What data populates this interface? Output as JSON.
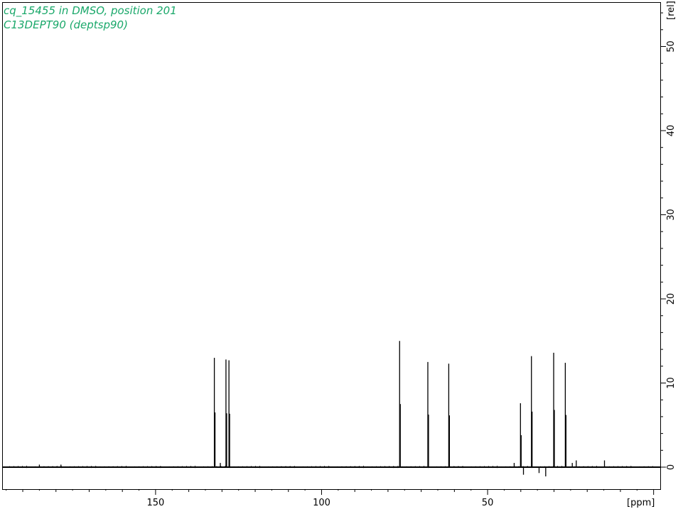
{
  "header": {
    "line1": "cq_15455 in DMSO, position 201",
    "line2": "C13DEPT90 (deptsp90)",
    "color": "#1aa86a"
  },
  "chart_data": {
    "type": "line",
    "xlabel": "[ppm]",
    "ylabel": "[rel]",
    "xlim": [
      196,
      -2
    ],
    "ylim": [
      -2.5,
      55
    ],
    "x_ticks": [
      150,
      100,
      50
    ],
    "x_tick_labels": [
      "150",
      "100",
      "50"
    ],
    "y_ticks": [
      0,
      10,
      20,
      30,
      40,
      50
    ],
    "y_tick_labels": [
      "0",
      "10",
      "20",
      "30",
      "40",
      "50"
    ],
    "baseline": 0,
    "peaks": [
      {
        "ppm": 132.3,
        "height": 13.0
      },
      {
        "ppm": 128.8,
        "height": 12.8
      },
      {
        "ppm": 127.9,
        "height": 12.7
      },
      {
        "ppm": 76.5,
        "height": 15.0
      },
      {
        "ppm": 68.0,
        "height": 12.5
      },
      {
        "ppm": 61.7,
        "height": 12.3
      },
      {
        "ppm": 40.1,
        "height": 7.6
      },
      {
        "ppm": 36.8,
        "height": 13.2
      },
      {
        "ppm": 30.1,
        "height": 13.6
      },
      {
        "ppm": 26.6,
        "height": 12.4
      },
      {
        "ppm": 24.5,
        "height": 0.5
      },
      {
        "ppm": 23.3,
        "height": 0.8
      },
      {
        "ppm": 14.8,
        "height": 0.8
      },
      {
        "ppm": 42.0,
        "height": 0.5
      },
      {
        "ppm": 130.5,
        "height": 0.5
      },
      {
        "ppm": 185.0,
        "height": 0.3
      },
      {
        "ppm": 178.5,
        "height": 0.3
      }
    ],
    "negative_peaks": [
      {
        "ppm": 39.2,
        "height": -0.9
      },
      {
        "ppm": 34.5,
        "height": -0.7
      },
      {
        "ppm": 32.5,
        "height": -1.1
      }
    ],
    "grid": false,
    "line_color": "#000000"
  }
}
